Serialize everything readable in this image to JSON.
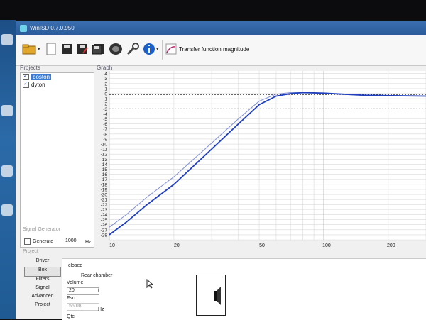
{
  "window": {
    "title": "WinISD 0.7.0.950"
  },
  "toolbar": {
    "buttons": [
      {
        "name": "open-icon"
      },
      {
        "name": "new-icon"
      },
      {
        "name": "save-icon"
      },
      {
        "name": "save-as-icon"
      },
      {
        "name": "save-all-icon"
      },
      {
        "name": "driver-icon"
      },
      {
        "name": "tools-icon"
      },
      {
        "name": "info-icon"
      }
    ],
    "graph_type_label": "Transfer function magnitude"
  },
  "projects": {
    "header": "Projects",
    "items": [
      {
        "name": "boston",
        "checked": true,
        "selected": true
      },
      {
        "name": "dyton",
        "checked": true,
        "selected": false
      }
    ]
  },
  "graph": {
    "header": "Graph",
    "y_ticks": [
      "4",
      "3",
      "2",
      "1",
      "0",
      "-1",
      "-2",
      "-3",
      "-4",
      "-5",
      "-6",
      "-7",
      "-8",
      "-9",
      "-10",
      "-11",
      "-12",
      "-13",
      "-14",
      "-15",
      "-16",
      "-17",
      "-18",
      "-19",
      "-20",
      "-21",
      "-22",
      "-23",
      "-24",
      "-25",
      "-26",
      "-27",
      "-28"
    ],
    "x_ticks": [
      "10",
      "20",
      "50",
      "100",
      "200"
    ]
  },
  "chart_data": {
    "type": "line",
    "ylim": [
      -29,
      4.5
    ],
    "xlim": [
      10,
      300
    ],
    "xscale": "log",
    "grid": true,
    "series": [
      {
        "color": "#1f3fbf",
        "x": [
          10,
          12,
          15,
          20,
          30,
          40,
          50,
          60,
          70,
          80,
          100,
          150,
          200,
          300
        ],
        "y": [
          -28,
          -25.5,
          -22,
          -18,
          -11,
          -6,
          -2.2,
          -0.5,
          0,
          0.2,
          0.1,
          -0.3,
          -0.4,
          -0.5
        ]
      },
      {
        "color": "#7f8fd6",
        "x": [
          10,
          12,
          15,
          20,
          30,
          40,
          50,
          60,
          70,
          80,
          100,
          150,
          200,
          300
        ],
        "y": [
          -26.5,
          -24,
          -20.5,
          -16.5,
          -9.8,
          -5,
          -1.5,
          -0.1,
          0.2,
          0.2,
          0,
          -0.3,
          -0.4,
          -0.5
        ]
      }
    ],
    "reference_lines": [
      -0.2,
      -3.0
    ]
  },
  "signal_generator": {
    "header": "Signal Generator",
    "generate_label": "Generate",
    "frequency": "1000",
    "unit": "Hz"
  },
  "project_panel": {
    "header": "Project",
    "tabs": [
      "Driver",
      "Box",
      "Filters",
      "Signal",
      "Advanced",
      "Project"
    ],
    "active_tab": "Box",
    "box": {
      "type": "closed",
      "section": "Rear chamber",
      "volume_label": "Volume",
      "volume_value": "20",
      "volume_unit": "l",
      "fsc_label": "Fsc",
      "fsc_value": "56.08",
      "fsc_unit": "Hz",
      "qtc_label": "Qtc"
    }
  }
}
